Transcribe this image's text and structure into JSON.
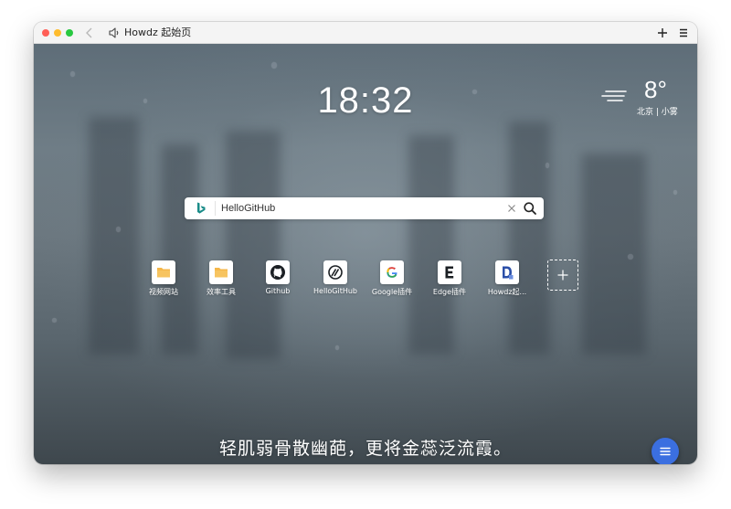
{
  "window": {
    "title": "Howdz 起始页"
  },
  "clock": {
    "time": "18:32"
  },
  "weather": {
    "temperature": "8°",
    "location": "北京 | 小雾",
    "icon": "fog-icon"
  },
  "search": {
    "engine_icon": "bing-icon",
    "value": "HelloGitHub"
  },
  "shortcuts": [
    {
      "label": "视频网站",
      "icon": "folder-icon"
    },
    {
      "label": "效率工具",
      "icon": "folder-icon"
    },
    {
      "label": "Github",
      "icon": "github-icon"
    },
    {
      "label": "HelloGitHub",
      "icon": "hellogithub-icon"
    },
    {
      "label": "Google插件",
      "icon": "google-icon"
    },
    {
      "label": "Edge插件",
      "icon": "edge-letter-icon"
    },
    {
      "label": "Howdz起...",
      "icon": "howdz-icon"
    }
  ],
  "quote": {
    "text": "轻肌弱骨散幽葩，更将金蕊泛流霞。"
  },
  "colors": {
    "accent": "#3b6fe0",
    "folder": "#f5b74a"
  }
}
